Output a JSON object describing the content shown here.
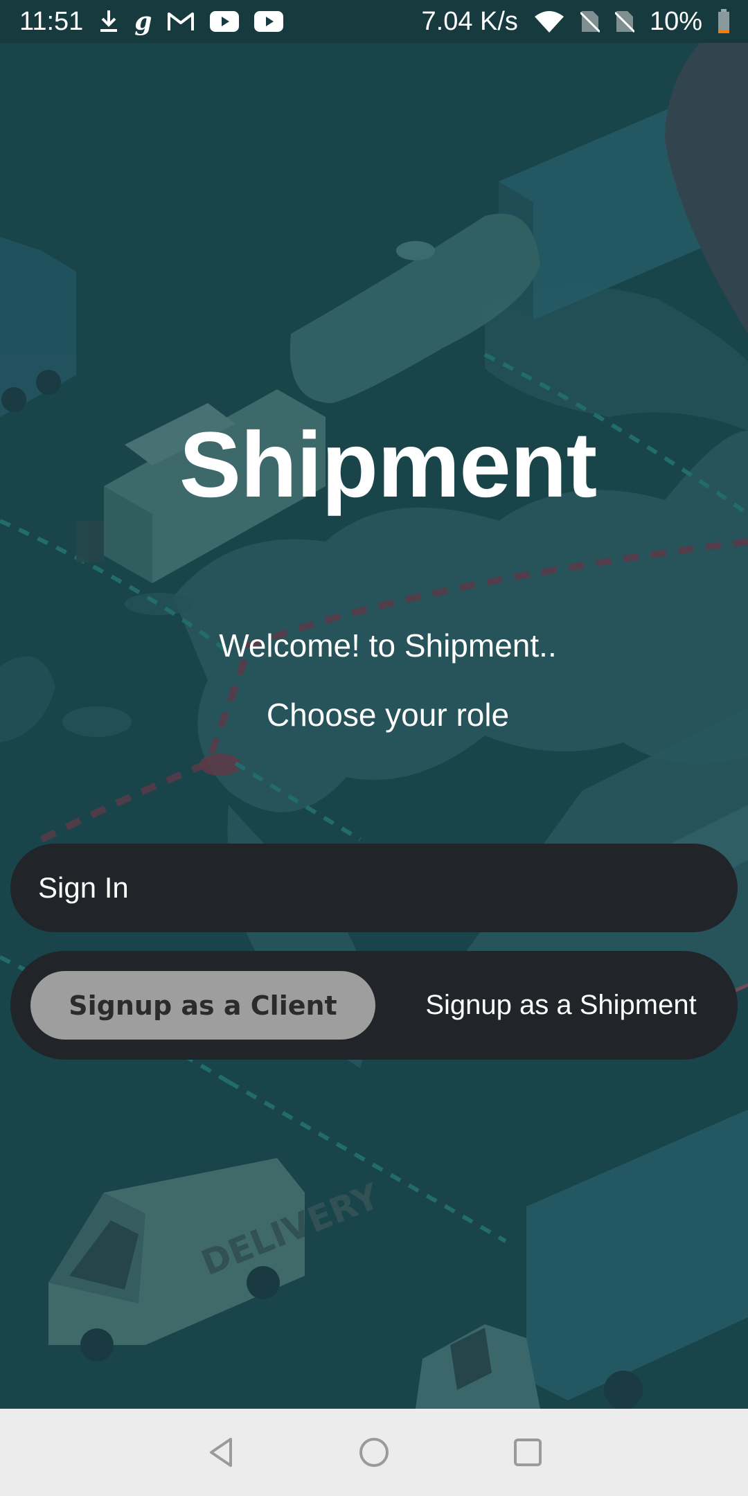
{
  "status_bar": {
    "time": "11:51",
    "net_speed": "7.04 K/s",
    "battery": "10%",
    "left_icons": [
      "download-icon",
      "g-app-icon",
      "gmail-icon",
      "youtube-icon",
      "youtube-icon"
    ],
    "right_icons": [
      "wifi-icon",
      "no-sim-icon",
      "no-sim-icon",
      "battery-low-icon"
    ],
    "g_glyph": "g"
  },
  "main": {
    "title": "Shipment",
    "welcome": "Welcome! to Shipment..",
    "subtitle": "Choose your role",
    "sign_in_label": "Sign In",
    "signup_client_label": "Signup as a Client",
    "signup_shipment_label": "Signup as a Shipment",
    "selected_signup": "Signup as a Client"
  },
  "background": {
    "truck_text": "DELIVERY"
  },
  "nav_bar": {
    "icons": [
      "back-icon",
      "home-icon",
      "recents-icon"
    ]
  },
  "colors": {
    "background": "#1c4a50",
    "status_bar": "#173a3f",
    "button_dark": "#212529",
    "toggle_selected": "#9e9e9e",
    "nav_bar": "#ececec"
  }
}
